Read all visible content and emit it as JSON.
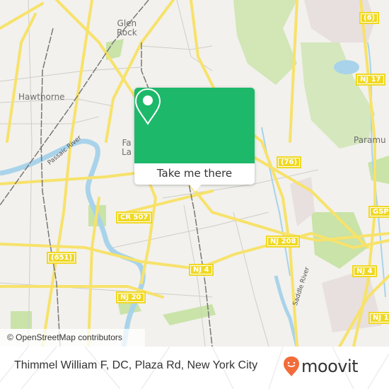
{
  "map": {
    "places": [
      {
        "id": "glen-rock",
        "label": "Glen\nRock"
      },
      {
        "id": "hawthorne",
        "label": "Hawthorne"
      },
      {
        "id": "fair-lawn",
        "label": "Fa\nLa"
      },
      {
        "id": "paramus",
        "label": "Paramu"
      }
    ],
    "route_shields": [
      {
        "id": "route-6",
        "label": "(6)"
      },
      {
        "id": "nj-17-top",
        "label": "NJ 17"
      },
      {
        "id": "route-76",
        "label": "(76)"
      },
      {
        "id": "gsp",
        "label": "GSP"
      },
      {
        "id": "cr-507",
        "label": "CR 507"
      },
      {
        "id": "nj-208",
        "label": "NJ 208"
      },
      {
        "id": "route-651",
        "label": "(651)"
      },
      {
        "id": "nj-4-center",
        "label": "NJ 4"
      },
      {
        "id": "nj-4-east",
        "label": "NJ 4"
      },
      {
        "id": "nj-20",
        "label": "NJ 20"
      },
      {
        "id": "nj-17-bottom",
        "label": "NJ 1"
      }
    ],
    "rivers": [
      {
        "id": "passaic-river",
        "label": "Passaic River"
      },
      {
        "id": "saddle-river",
        "label": "Saddle River"
      }
    ],
    "attribution": "© OpenStreetMap contributors",
    "colors": {
      "land": "#f2f1ed",
      "road": "#f7e26b",
      "water": "#a9d3ea",
      "park": "#c9e3a8"
    }
  },
  "popup": {
    "icon": "map-pin-icon",
    "button_label": "Take me there",
    "accent": "#1db86a"
  },
  "footer": {
    "address": "Thimmel William F, DC, Plaza Rd, New York City",
    "brand": "moovit",
    "brand_color": "#f26b3a"
  }
}
